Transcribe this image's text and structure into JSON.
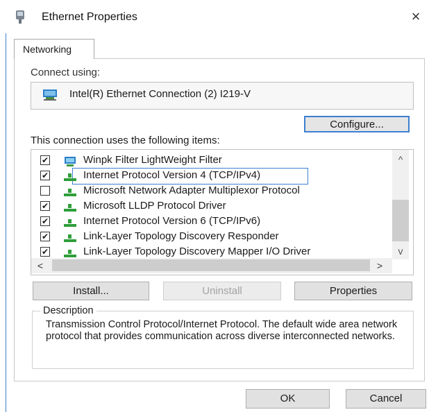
{
  "window": {
    "title": "Ethernet Properties",
    "close_glyph": "×"
  },
  "tabs": [
    {
      "label": "Networking",
      "active": true
    }
  ],
  "connect_using": {
    "label": "Connect using:",
    "adapter": "Intel(R) Ethernet Connection (2) I219-V"
  },
  "configure_label": "Configure...",
  "items_label": "This connection uses the following items:",
  "items": [
    {
      "label": "Winpk Filter LightWeight Filter",
      "checked": true,
      "icon": "filter-icon"
    },
    {
      "label": "Internet Protocol Version 4 (TCP/IPv4)",
      "checked": true,
      "icon": "protocol-icon",
      "selected": true
    },
    {
      "label": "Microsoft Network Adapter Multiplexor Protocol",
      "checked": false,
      "icon": "protocol-icon"
    },
    {
      "label": "Microsoft LLDP Protocol Driver",
      "checked": true,
      "icon": "protocol-icon"
    },
    {
      "label": "Internet Protocol Version 6 (TCP/IPv6)",
      "checked": true,
      "icon": "protocol-icon"
    },
    {
      "label": "Link-Layer Topology Discovery Responder",
      "checked": true,
      "icon": "protocol-icon"
    },
    {
      "label": "Link-Layer Topology Discovery Mapper I/O Driver",
      "checked": true,
      "icon": "protocol-icon"
    }
  ],
  "scroll": {
    "up": "^",
    "down": "v",
    "left": "<",
    "right": ">"
  },
  "buttons": {
    "install": "Install...",
    "uninstall": "Uninstall",
    "properties": "Properties",
    "ok": "OK",
    "cancel": "Cancel"
  },
  "description": {
    "title": "Description",
    "text": "Transmission Control Protocol/Internet Protocol. The default wide area network protocol that provides communication across diverse interconnected networks."
  },
  "colors": {
    "accent": "#3c7fcf",
    "protocol_green": "#2e9e3a"
  }
}
